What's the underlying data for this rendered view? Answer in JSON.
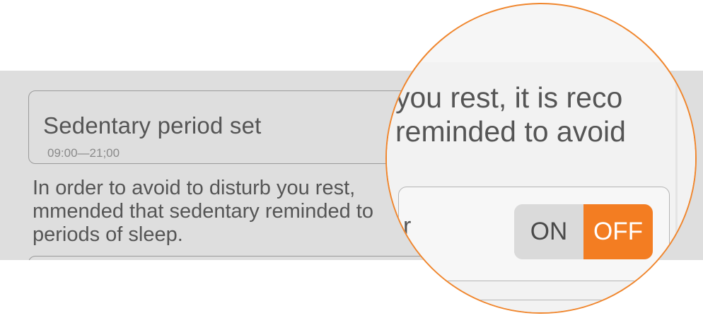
{
  "sedentary": {
    "title": "Sedentary period set",
    "range": "09:00—21;00"
  },
  "notice": {
    "line1": "In order to avoid to disturb you rest,",
    "line2": "mmended that sedentary reminded to",
    "line3": "periods of sleep."
  },
  "zoom": {
    "line1": "you rest, it is reco",
    "line2": "reminded to avoid",
    "card_fragment": "r"
  },
  "toggle": {
    "on_label": "ON",
    "off_label": "OFF",
    "state": "off",
    "active_color": "#f37d22"
  },
  "colors": {
    "accent": "#f37d22",
    "lens_border": "#f0862d",
    "background": "#dedede"
  }
}
